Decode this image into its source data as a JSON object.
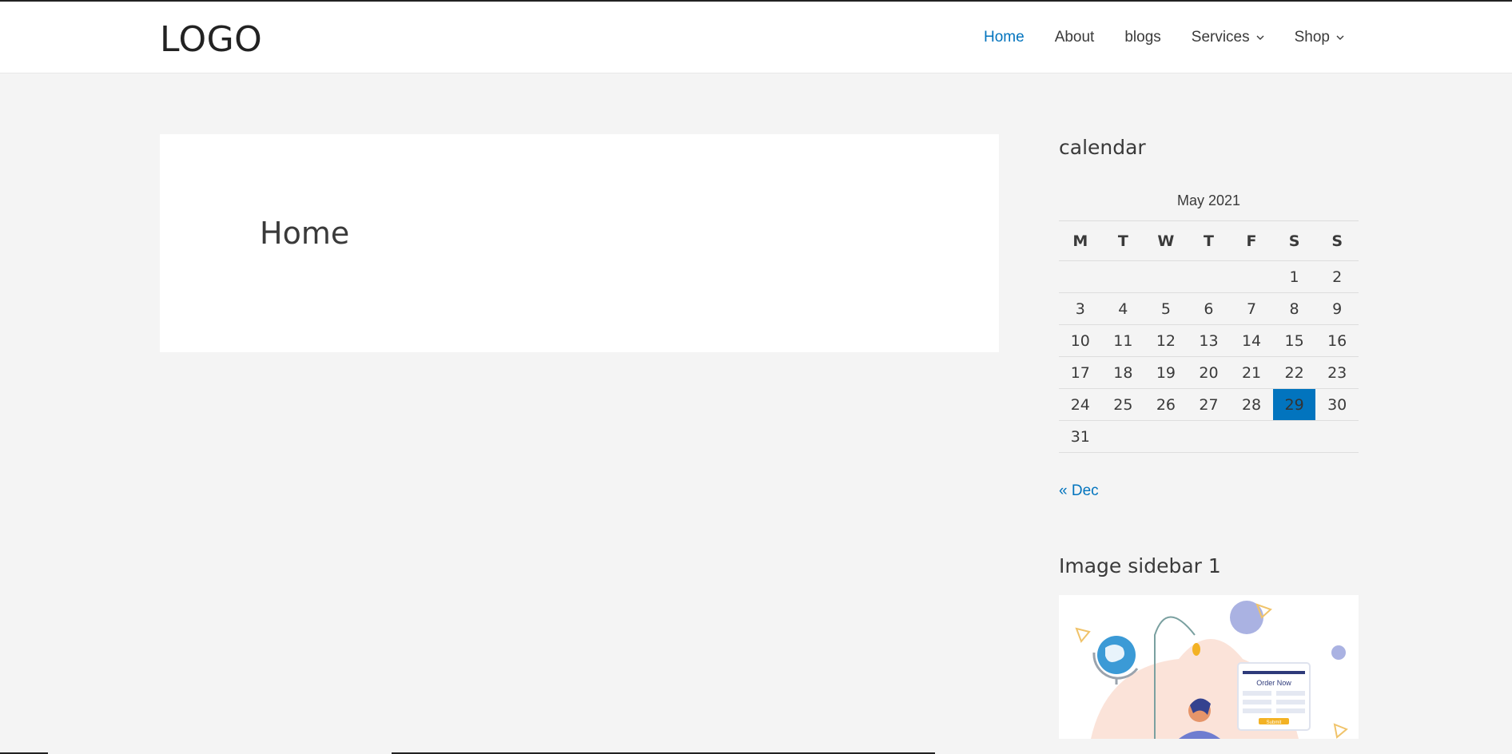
{
  "header": {
    "logo": "LOGO",
    "nav": [
      {
        "label": "Home",
        "active": true,
        "has_dropdown": false
      },
      {
        "label": "About",
        "active": false,
        "has_dropdown": false
      },
      {
        "label": "blogs",
        "active": false,
        "has_dropdown": false
      },
      {
        "label": "Services",
        "active": false,
        "has_dropdown": true
      },
      {
        "label": "Shop",
        "active": false,
        "has_dropdown": true
      }
    ]
  },
  "main": {
    "title": "Home"
  },
  "sidebar": {
    "calendar": {
      "title": "calendar",
      "caption": "May 2021",
      "weekdays": [
        "M",
        "T",
        "W",
        "T",
        "F",
        "S",
        "S"
      ],
      "weeks": [
        [
          "",
          "",
          "",
          "",
          "",
          "1",
          "2"
        ],
        [
          "3",
          "4",
          "5",
          "6",
          "7",
          "8",
          "9"
        ],
        [
          "10",
          "11",
          "12",
          "13",
          "14",
          "15",
          "16"
        ],
        [
          "17",
          "18",
          "19",
          "20",
          "21",
          "22",
          "23"
        ],
        [
          "24",
          "25",
          "26",
          "27",
          "28",
          "29",
          "30"
        ],
        [
          "31",
          "",
          "",
          "",
          "",
          "",
          ""
        ]
      ],
      "today": "29",
      "prev_link": "« Dec"
    },
    "image_widget": {
      "title": "Image sidebar 1",
      "illustration_text": {
        "heading": "Order Now",
        "button": "Submit"
      }
    }
  },
  "colors": {
    "accent": "#0274be",
    "background": "#f4f4f4",
    "text": "#3a3a3a"
  }
}
